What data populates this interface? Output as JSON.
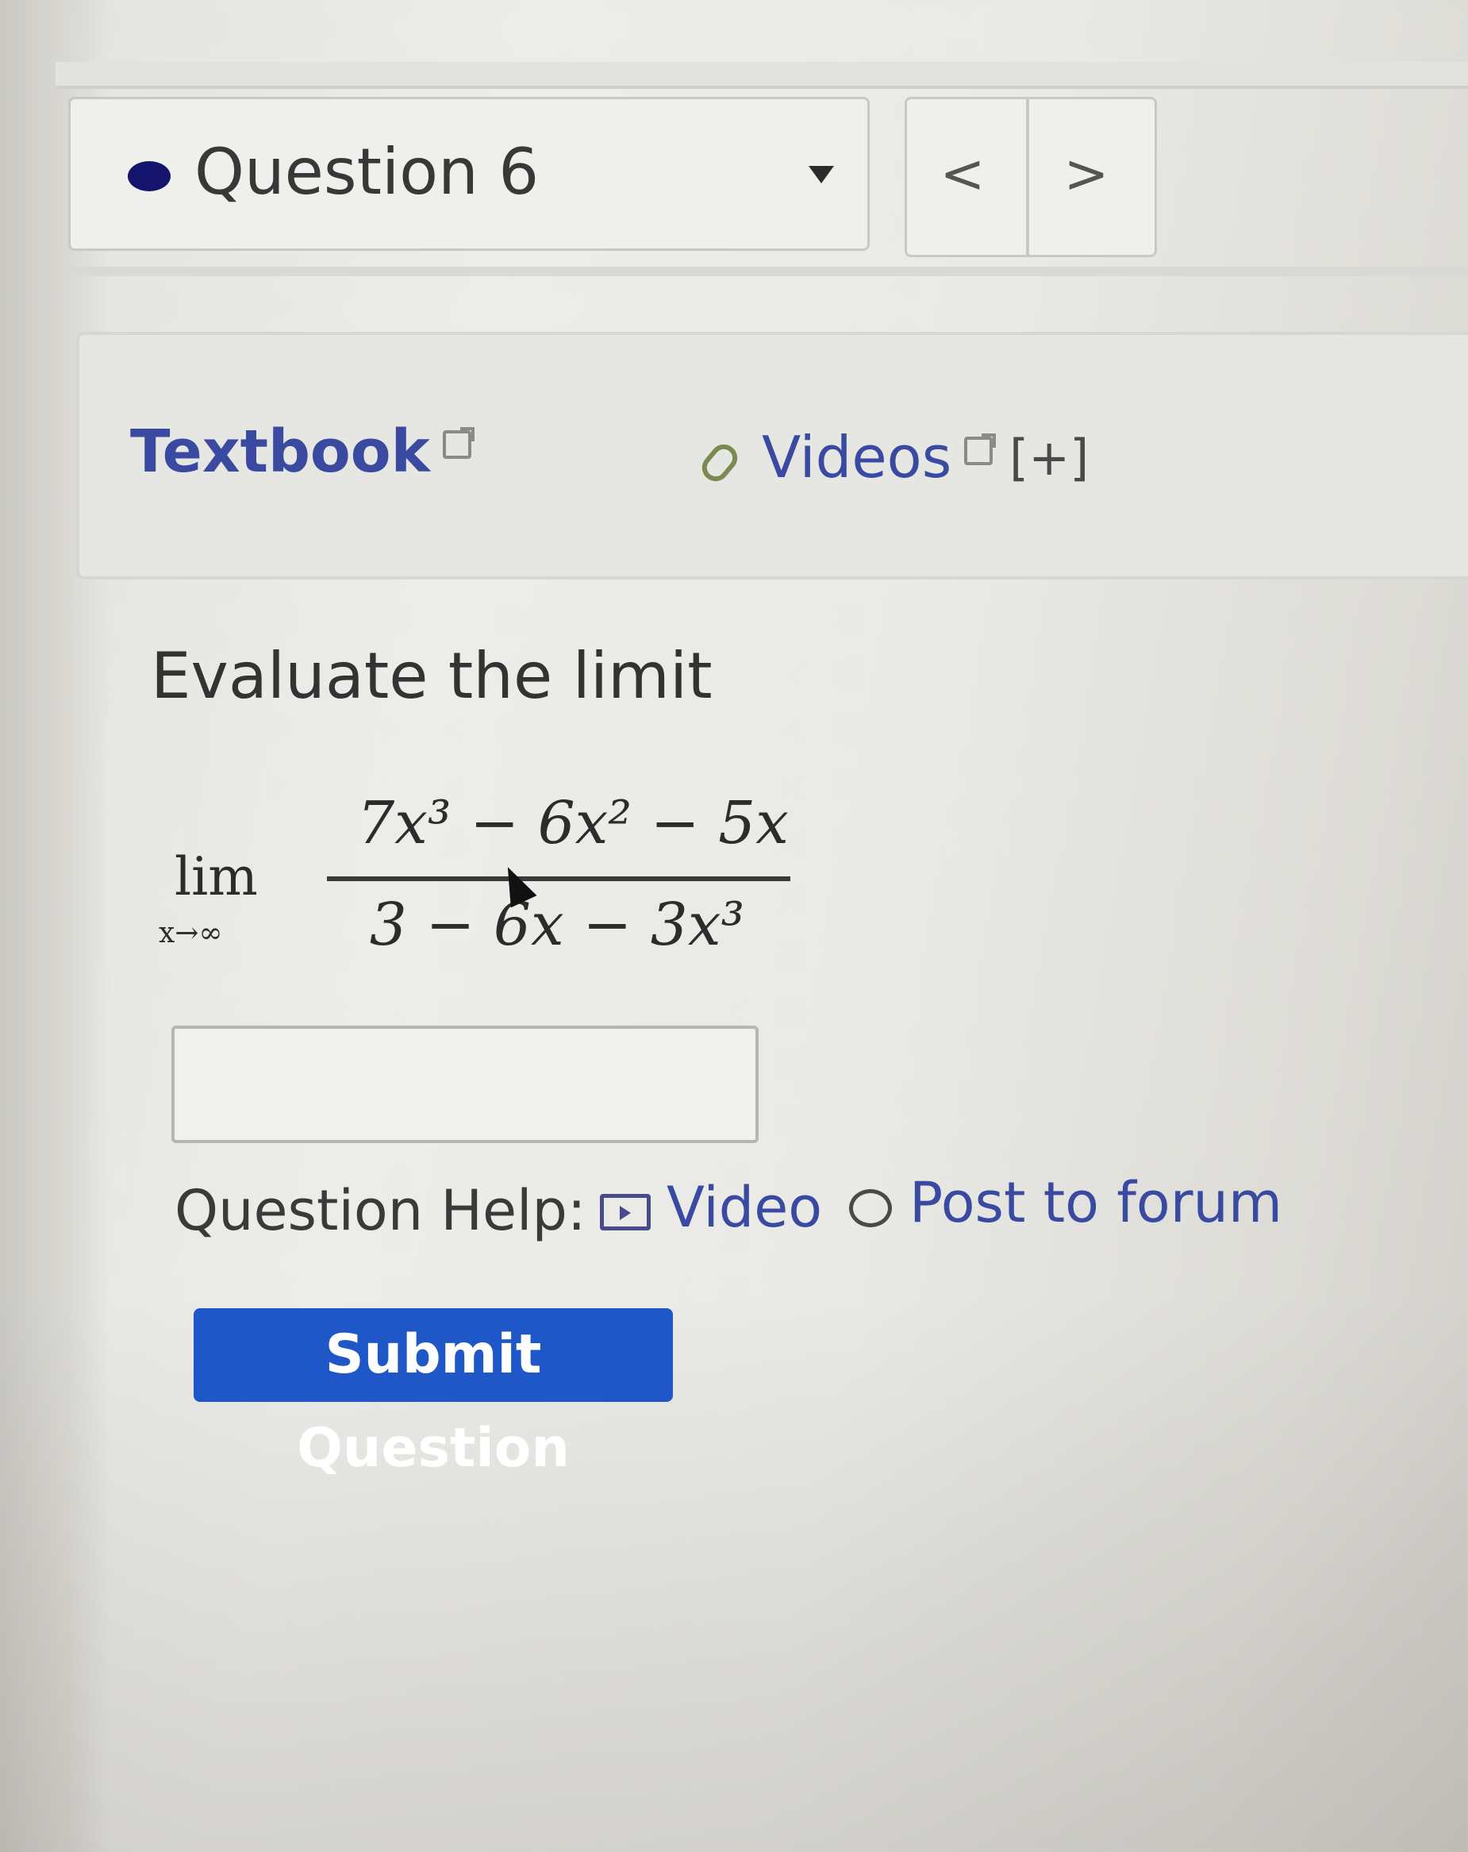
{
  "question_nav": {
    "label": "Question 6",
    "prev_label": "<",
    "next_label": ">"
  },
  "resources": {
    "textbook_label": "Textbook",
    "videos_label": "Videos",
    "videos_expand": "[+]"
  },
  "question": {
    "prompt": "Evaluate the limit",
    "limit_word": "lim",
    "limit_sub": "x→∞",
    "numerator": "7x³ − 6x² − 5x",
    "denominator": "3 − 6x − 3x³"
  },
  "answer": {
    "value": ""
  },
  "help": {
    "label": "Question Help:",
    "video_label": "Video",
    "forum_label": "Post to forum"
  },
  "submit": {
    "label": "Submit Question"
  },
  "colors": {
    "link": "#3a4aa0",
    "submit_bg": "#1f57c9",
    "status_dot": "#14146e"
  }
}
